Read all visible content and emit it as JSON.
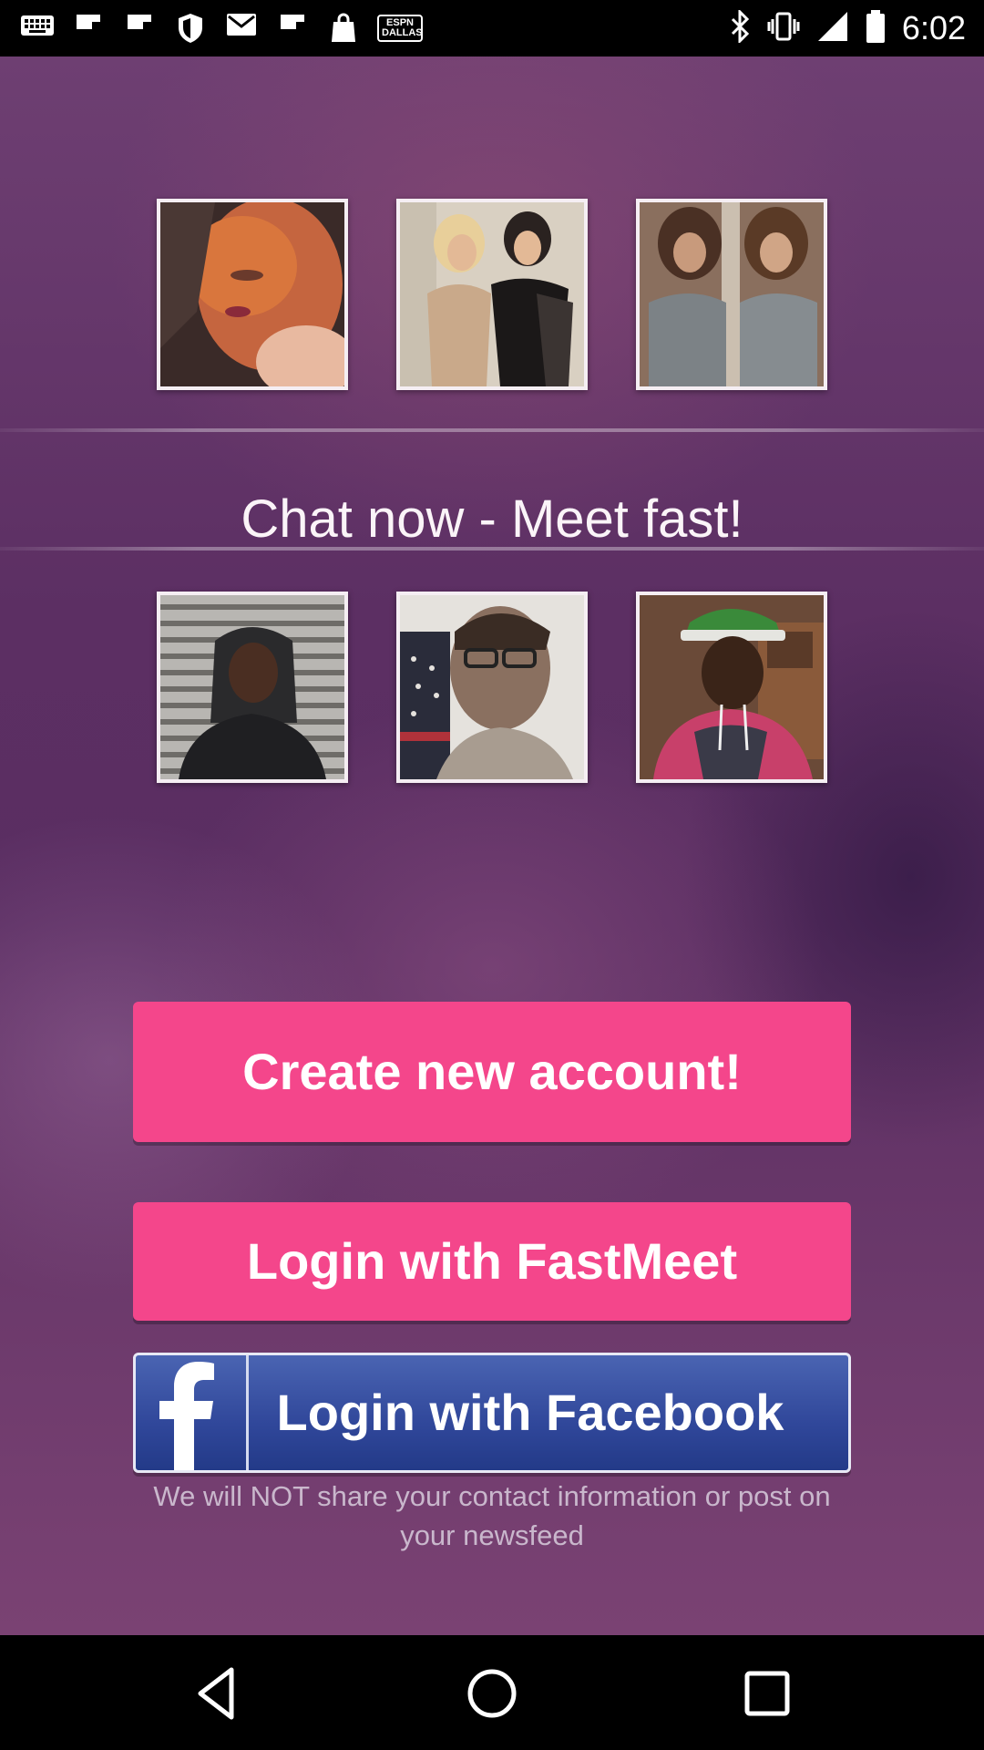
{
  "status_bar": {
    "time": "6:02",
    "left_icons": [
      "keyboard-icon",
      "flipboard-icon",
      "flipboard-icon",
      "shield-icon",
      "gmail-icon",
      "flipboard-icon",
      "shopping-bag-icon",
      "espn-dallas-icon"
    ],
    "espn_badge_line1": "ESPN",
    "espn_badge_line2": "DALLAS",
    "right_icons": [
      "bluetooth-icon",
      "vibrate-icon",
      "signal-icon",
      "battery-icon"
    ]
  },
  "tagline": "Chat now - Meet fast!",
  "photos_top": [
    {
      "name": "profile-photo-woman-1"
    },
    {
      "name": "profile-photo-women-2"
    },
    {
      "name": "profile-photo-women-3"
    }
  ],
  "photos_bottom": [
    {
      "name": "profile-photo-man-1"
    },
    {
      "name": "profile-photo-man-2"
    },
    {
      "name": "profile-photo-man-3"
    }
  ],
  "buttons": {
    "create_account": "Create new account!",
    "login_fastmeet": "Login with FastMeet",
    "login_facebook": "Login with Facebook"
  },
  "disclaimer": "We will NOT share your contact information or post on your newsfeed",
  "colors": {
    "pink_button": "#f4468b",
    "facebook_blue": "#30479a",
    "background": "#5c2f63"
  },
  "nav_bar": {
    "icons": [
      "back-icon",
      "home-icon",
      "recents-icon"
    ]
  }
}
